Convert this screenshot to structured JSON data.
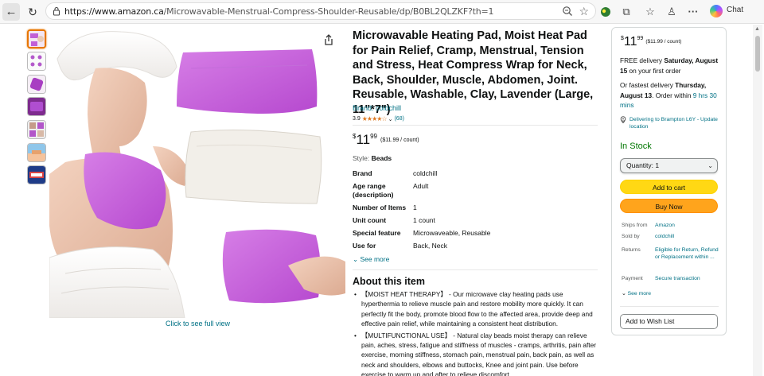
{
  "browser": {
    "url_prefix": "https://www.amazon.ca",
    "url_path": "/Microwavable-Menstrual-Compress-Shoulder-Reusable/dp/B0BL2QLZKF?th=1",
    "chat_label": "Chat",
    "icons": [
      "back-icon",
      "reload-icon",
      "lock-icon",
      "zoom-icon",
      "star-icon",
      "extension-icon",
      "puzzle-icon",
      "favorites-icon",
      "profile-icon",
      "more-icon",
      "copilot-icon"
    ]
  },
  "product": {
    "title": "Microwavable Heating Pad, Moist Heat Pad for Pain Relief, Cramp, Menstrual, Tension and Stress, Heat Compress Wrap for Neck, Back, Shoulder, Muscle, Abdomen, Joint. Reusable, Washable, Clay, Lavender (Large, 11\"*7\")",
    "brand_link": "Brand: coldchill",
    "rating": "3.9",
    "stars": "★★★★☆",
    "rating_count": "(68)",
    "price_symbol": "$",
    "price_whole": "11",
    "price_fraction": "99",
    "price_unit": "($11.99 / count)",
    "style_label": "Style:",
    "style_value": "Beads",
    "see_full_view": "Click to see full view",
    "specs": [
      {
        "key": "Brand",
        "value": "coldchill"
      },
      {
        "key": "Age range (description)",
        "value": "Adult"
      },
      {
        "key": "Number of Items",
        "value": "1"
      },
      {
        "key": "Unit count",
        "value": "1 count"
      },
      {
        "key": "Special feature",
        "value": "Microwaveable, Reusable"
      },
      {
        "key": "Use for",
        "value": "Back, Neck"
      }
    ],
    "see_more": "See more",
    "about_title": "About this item",
    "about_bullets": [
      "【MOIST HEAT THERAPY】 - Our microwave clay heating pads use hyperthermia to relieve muscle pain and restore mobility more quickly. It can perfectly fit the body, promote blood flow to the affected area, provide deep and effective pain relief, while maintaining a consistent heat distribution.",
      "【MULTIFUNCTIONAL USE】 - Natural clay beads moist therapy can relieve pain, aches, stress, fatigue and stiffness of muscles - cramps, arthritis, pain after exercise, morning stiffness, stomach pain, menstrual pain, back pain, as well as neck and shoulders, elbows and buttocks, Knee and joint pain. Use before exercise to warm up and after to relieve discomfort."
    ],
    "colors": {
      "lavender": "#c25fd6",
      "link": "#007185",
      "star": "#de7921"
    }
  },
  "buybox": {
    "price_symbol": "$",
    "price_whole": "11",
    "price_fraction": "99",
    "price_unit": "($11.99 / count)",
    "free_delivery_prefix": "FREE delivery",
    "free_delivery_date": "Saturday, August 15",
    "free_delivery_suffix": "on your first order",
    "fastest_prefix": "Or fastest delivery",
    "fastest_date": "Thursday, August 13",
    "order_within_prefix": ". Order within",
    "order_within_time": "9 hrs 30 mins",
    "deliver_to": "Delivering to Brampton L6Y - Update location",
    "in_stock": "In Stock",
    "quantity": "Quantity:  1",
    "add_to_cart": "Add to cart",
    "buy_now": "Buy Now",
    "info": [
      {
        "key": "Ships from",
        "value": "Amazon"
      },
      {
        "key": "Sold by",
        "value": "coldchill"
      },
      {
        "key": "Returns",
        "value": "Eligible for Return, Refund or Replacement within ..."
      },
      {
        "key": "Payment",
        "value": "Secure transaction"
      }
    ],
    "see_more": "See more",
    "add_to_wish_list": "Add to Wish List",
    "colors": {
      "cart": "#ffd814",
      "buy": "#ffa41c",
      "in_stock": "#007600"
    }
  }
}
